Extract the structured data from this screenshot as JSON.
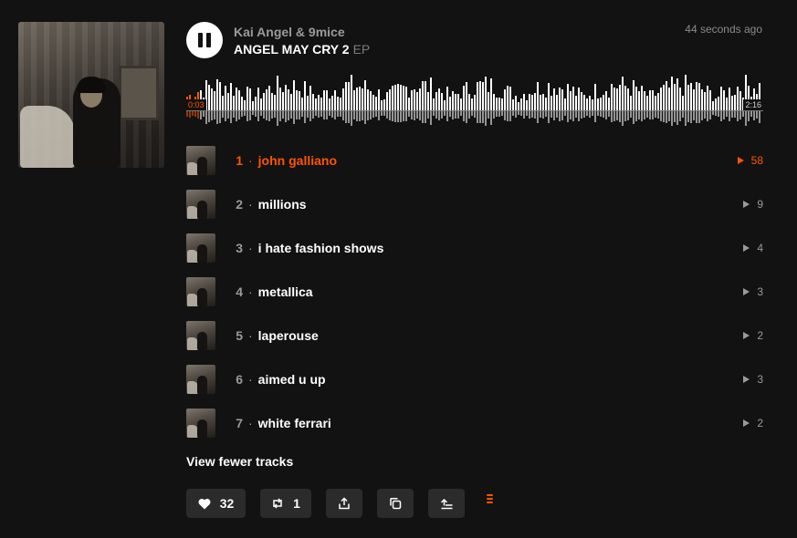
{
  "player": {
    "artist": "Kai Angel & 9mice",
    "title": "ANGEL MAY CRY 2",
    "type": "EP",
    "posted": "44 seconds ago",
    "state": "playing",
    "current_time": "0:03",
    "total_time": "2:16",
    "progress": 0.022
  },
  "tracks": [
    {
      "number": "1",
      "name": "john galliano",
      "plays": "58",
      "active": true
    },
    {
      "number": "2",
      "name": "millions",
      "plays": "9",
      "active": false
    },
    {
      "number": "3",
      "name": "i hate fashion shows",
      "plays": "4",
      "active": false
    },
    {
      "number": "4",
      "name": "metallica",
      "plays": "3",
      "active": false
    },
    {
      "number": "5",
      "name": "laperouse",
      "plays": "2",
      "active": false
    },
    {
      "number": "6",
      "name": "aimed u up",
      "plays": "3",
      "active": false
    },
    {
      "number": "7",
      "name": "white ferrari",
      "plays": "2",
      "active": false
    }
  ],
  "track_separator": "·",
  "view_toggle": "View fewer tracks",
  "actions": {
    "like_count": "32",
    "repost_count": "1",
    "icons": [
      "heart-icon",
      "repost-icon",
      "share-icon",
      "copy-link-icon",
      "add-to-next-up-icon",
      "more-icon"
    ]
  },
  "colors": {
    "accent": "#ff5500",
    "background": "#121212",
    "button": "#2b2b2b",
    "text_muted": "#9a9a9a"
  }
}
